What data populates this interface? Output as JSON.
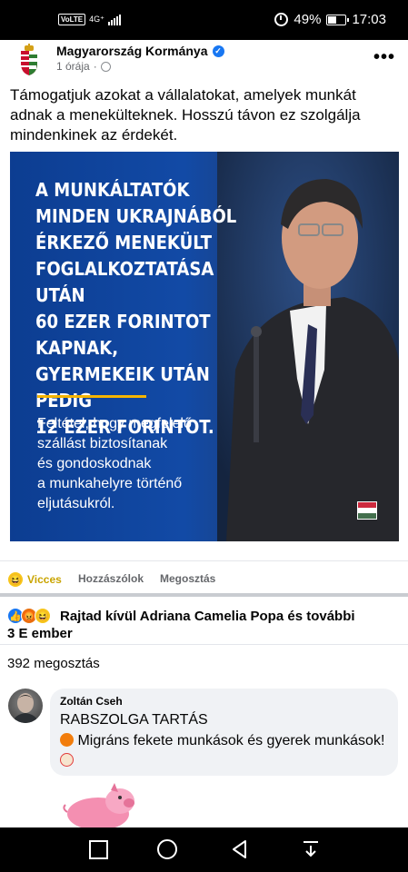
{
  "status_bar": {
    "volte": "VoLTE",
    "network": "4G⁺",
    "battery": "49%",
    "time": "17:03"
  },
  "post": {
    "page_name": "Magyarország Kormánya",
    "time": "1 órája",
    "text": "Támogatjuk azokat a vállalatokat, amelyek munkát adnak a menekülteknek. Hosszú távon ez szolgálja mindenkinek az érdekét."
  },
  "image": {
    "headline": [
      "A MUNKÁLTATÓK",
      "MINDEN UKRAJNÁBÓL",
      "ÉRKEZŐ MENEKÜLT",
      "FOGLALKOZTATÁSA UTÁN",
      "60 EZER FORINTOT KAPNAK,",
      "GYERMEKEIK UTÁN PEDIG",
      "12 EZER FORINTOT."
    ],
    "subtext": [
      "Feltétel, hogy megfelelő",
      "szállást biztosítanak",
      "és gondoskodnak",
      "a munkahelyre történő",
      "eljutásukról."
    ],
    "accent_color": "#f5b400"
  },
  "actions": {
    "reaction": "Vicces",
    "comment": "Hozzászólok",
    "share": "Megosztás"
  },
  "reactions_summary": {
    "line1": "Rajtad kívül Adriana Camelia Popa és további",
    "line2": "3 E ember"
  },
  "shares": "392 megosztás",
  "comment": {
    "author": "Zoltán Cseh",
    "line1": "RABSZOLGA TARTÁS",
    "line2": "Migráns fekete munkások és gyerek munkások!"
  },
  "colors": {
    "facebook_blue": "#1877f2",
    "image_blue": "#124aa6"
  }
}
